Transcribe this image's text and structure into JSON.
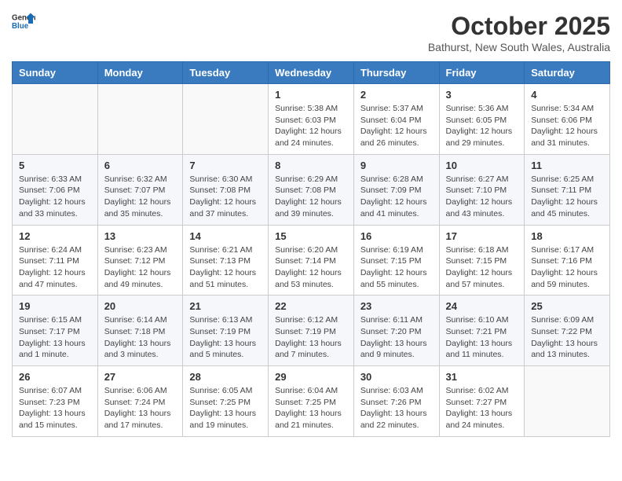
{
  "header": {
    "logo_general": "General",
    "logo_blue": "Blue",
    "month": "October 2025",
    "location": "Bathurst, New South Wales, Australia"
  },
  "days_of_week": [
    "Sunday",
    "Monday",
    "Tuesday",
    "Wednesday",
    "Thursday",
    "Friday",
    "Saturday"
  ],
  "weeks": [
    [
      {
        "day": "",
        "info": ""
      },
      {
        "day": "",
        "info": ""
      },
      {
        "day": "",
        "info": ""
      },
      {
        "day": "1",
        "info": "Sunrise: 5:38 AM\nSunset: 6:03 PM\nDaylight: 12 hours\nand 24 minutes."
      },
      {
        "day": "2",
        "info": "Sunrise: 5:37 AM\nSunset: 6:04 PM\nDaylight: 12 hours\nand 26 minutes."
      },
      {
        "day": "3",
        "info": "Sunrise: 5:36 AM\nSunset: 6:05 PM\nDaylight: 12 hours\nand 29 minutes."
      },
      {
        "day": "4",
        "info": "Sunrise: 5:34 AM\nSunset: 6:06 PM\nDaylight: 12 hours\nand 31 minutes."
      }
    ],
    [
      {
        "day": "5",
        "info": "Sunrise: 6:33 AM\nSunset: 7:06 PM\nDaylight: 12 hours\nand 33 minutes."
      },
      {
        "day": "6",
        "info": "Sunrise: 6:32 AM\nSunset: 7:07 PM\nDaylight: 12 hours\nand 35 minutes."
      },
      {
        "day": "7",
        "info": "Sunrise: 6:30 AM\nSunset: 7:08 PM\nDaylight: 12 hours\nand 37 minutes."
      },
      {
        "day": "8",
        "info": "Sunrise: 6:29 AM\nSunset: 7:08 PM\nDaylight: 12 hours\nand 39 minutes."
      },
      {
        "day": "9",
        "info": "Sunrise: 6:28 AM\nSunset: 7:09 PM\nDaylight: 12 hours\nand 41 minutes."
      },
      {
        "day": "10",
        "info": "Sunrise: 6:27 AM\nSunset: 7:10 PM\nDaylight: 12 hours\nand 43 minutes."
      },
      {
        "day": "11",
        "info": "Sunrise: 6:25 AM\nSunset: 7:11 PM\nDaylight: 12 hours\nand 45 minutes."
      }
    ],
    [
      {
        "day": "12",
        "info": "Sunrise: 6:24 AM\nSunset: 7:11 PM\nDaylight: 12 hours\nand 47 minutes."
      },
      {
        "day": "13",
        "info": "Sunrise: 6:23 AM\nSunset: 7:12 PM\nDaylight: 12 hours\nand 49 minutes."
      },
      {
        "day": "14",
        "info": "Sunrise: 6:21 AM\nSunset: 7:13 PM\nDaylight: 12 hours\nand 51 minutes."
      },
      {
        "day": "15",
        "info": "Sunrise: 6:20 AM\nSunset: 7:14 PM\nDaylight: 12 hours\nand 53 minutes."
      },
      {
        "day": "16",
        "info": "Sunrise: 6:19 AM\nSunset: 7:15 PM\nDaylight: 12 hours\nand 55 minutes."
      },
      {
        "day": "17",
        "info": "Sunrise: 6:18 AM\nSunset: 7:15 PM\nDaylight: 12 hours\nand 57 minutes."
      },
      {
        "day": "18",
        "info": "Sunrise: 6:17 AM\nSunset: 7:16 PM\nDaylight: 12 hours\nand 59 minutes."
      }
    ],
    [
      {
        "day": "19",
        "info": "Sunrise: 6:15 AM\nSunset: 7:17 PM\nDaylight: 13 hours\nand 1 minute."
      },
      {
        "day": "20",
        "info": "Sunrise: 6:14 AM\nSunset: 7:18 PM\nDaylight: 13 hours\nand 3 minutes."
      },
      {
        "day": "21",
        "info": "Sunrise: 6:13 AM\nSunset: 7:19 PM\nDaylight: 13 hours\nand 5 minutes."
      },
      {
        "day": "22",
        "info": "Sunrise: 6:12 AM\nSunset: 7:19 PM\nDaylight: 13 hours\nand 7 minutes."
      },
      {
        "day": "23",
        "info": "Sunrise: 6:11 AM\nSunset: 7:20 PM\nDaylight: 13 hours\nand 9 minutes."
      },
      {
        "day": "24",
        "info": "Sunrise: 6:10 AM\nSunset: 7:21 PM\nDaylight: 13 hours\nand 11 minutes."
      },
      {
        "day": "25",
        "info": "Sunrise: 6:09 AM\nSunset: 7:22 PM\nDaylight: 13 hours\nand 13 minutes."
      }
    ],
    [
      {
        "day": "26",
        "info": "Sunrise: 6:07 AM\nSunset: 7:23 PM\nDaylight: 13 hours\nand 15 minutes."
      },
      {
        "day": "27",
        "info": "Sunrise: 6:06 AM\nSunset: 7:24 PM\nDaylight: 13 hours\nand 17 minutes."
      },
      {
        "day": "28",
        "info": "Sunrise: 6:05 AM\nSunset: 7:25 PM\nDaylight: 13 hours\nand 19 minutes."
      },
      {
        "day": "29",
        "info": "Sunrise: 6:04 AM\nSunset: 7:25 PM\nDaylight: 13 hours\nand 21 minutes."
      },
      {
        "day": "30",
        "info": "Sunrise: 6:03 AM\nSunset: 7:26 PM\nDaylight: 13 hours\nand 22 minutes."
      },
      {
        "day": "31",
        "info": "Sunrise: 6:02 AM\nSunset: 7:27 PM\nDaylight: 13 hours\nand 24 minutes."
      },
      {
        "day": "",
        "info": ""
      }
    ]
  ]
}
